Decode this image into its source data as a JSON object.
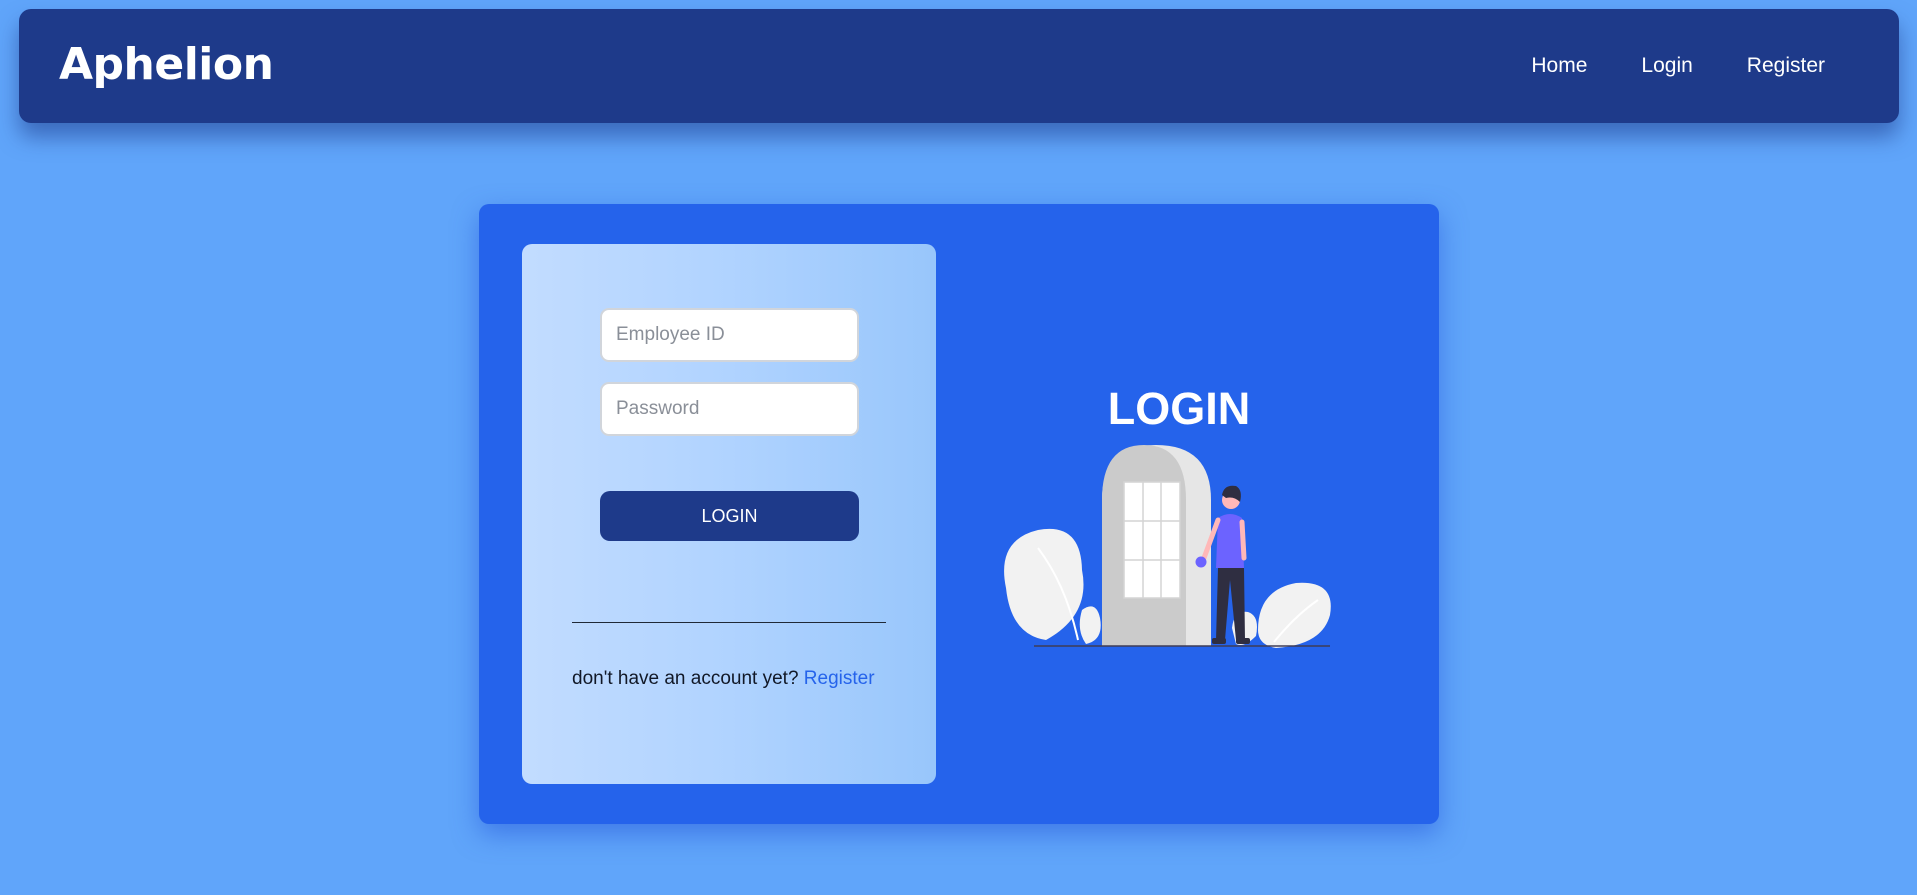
{
  "navbar": {
    "brand": "Aphelion",
    "links": [
      {
        "label": "Home"
      },
      {
        "label": "Login"
      },
      {
        "label": "Register"
      }
    ]
  },
  "login_form": {
    "employee_id": {
      "placeholder": "Employee ID",
      "value": ""
    },
    "password": {
      "placeholder": "Password",
      "value": ""
    },
    "submit_label": "LOGIN",
    "register_prompt": "don't have an account yet?",
    "register_link": "Register"
  },
  "hero": {
    "title": "LOGIN",
    "illustration_icon": "person-at-door-icon"
  },
  "colors": {
    "page_background": "#60a5fa",
    "navbar": "#1e3a8a",
    "card": "#2563eb",
    "button": "#1e3a8a",
    "link": "#2563eb",
    "figure_shirt": "#6c63ff"
  }
}
